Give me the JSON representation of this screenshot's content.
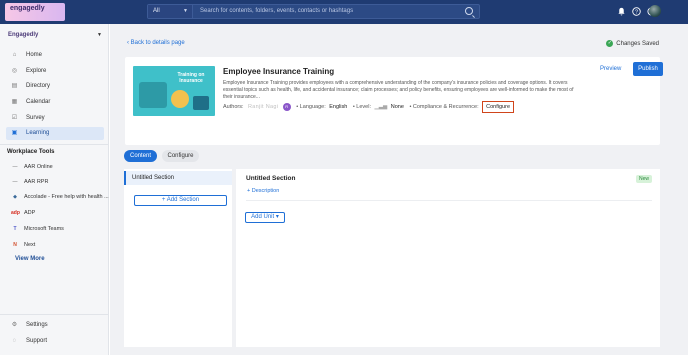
{
  "header": {
    "logo_text": "engagedly",
    "search_scope": "All",
    "search_placeholder": "Search for contents, folders, events, contacts or hashtags",
    "icons": [
      "bell-icon",
      "help-icon",
      "theme-icon",
      "avatar"
    ]
  },
  "sidebar": {
    "org_name": "Engagedly",
    "items": [
      {
        "label": "Home",
        "icon": "home-icon"
      },
      {
        "label": "Explore",
        "icon": "compass-icon"
      },
      {
        "label": "Directory",
        "icon": "directory-icon"
      },
      {
        "label": "Calendar",
        "icon": "calendar-icon"
      },
      {
        "label": "Survey",
        "icon": "survey-icon"
      },
      {
        "label": "Learning",
        "icon": "learning-icon",
        "active": true
      }
    ],
    "tools_title": "Workplace Tools",
    "tools": [
      {
        "label": "AAR Online",
        "icon": "aar-icon"
      },
      {
        "label": "AAR RPR",
        "icon": "aar-icon"
      },
      {
        "label": "Accolade - Free help with health ...",
        "icon": "accolade-icon"
      },
      {
        "label": "ADP",
        "icon": "adp-icon"
      },
      {
        "label": "Microsoft Teams",
        "icon": "teams-icon"
      },
      {
        "label": "Next",
        "icon": "next-icon"
      }
    ],
    "view_more": "View More",
    "footer": [
      {
        "label": "Settings",
        "icon": "gear-icon"
      },
      {
        "label": "Support",
        "icon": "support-icon"
      }
    ]
  },
  "main": {
    "back_link": "Back to details page",
    "changes_saved": "Changes Saved",
    "course": {
      "thumb_title": "Training on Insurance",
      "title": "Employee Insurance Training",
      "description": "Employee Insurance Training provides employees with a comprehensive understanding of the company's insurance policies and coverage options. It covers essential topics such as health, life, and accidental insurance; claim processes; and policy benefits, ensuring employees are well-informed to make the most of their insurance...",
      "authors_label": "Authors:",
      "author_name": "Ranjit Nagi",
      "author_initial": "R",
      "language_label": "• Language:",
      "language_value": "English",
      "level_label": "• Level:",
      "level_value": "None",
      "compliance_label": "• Compliance & Recurrence:",
      "compliance_value": "Configure",
      "preview_label": "Preview",
      "publish_label": "Publish"
    },
    "tabs": [
      {
        "label": "Content",
        "active": true
      },
      {
        "label": "Configure",
        "active": false
      }
    ],
    "outline": {
      "section_label": "Untitled Section",
      "add_section_label": "+ Add Section"
    },
    "detail": {
      "section_title": "Untitled Section",
      "badge": "New",
      "description_link": "+ Description",
      "add_unit_label": "Add Unit ▾"
    }
  },
  "colors": {
    "topbar": "#1f3b72",
    "accent": "#1f6fd6",
    "highlight_box": "#d0451b",
    "success": "#3aa655"
  }
}
